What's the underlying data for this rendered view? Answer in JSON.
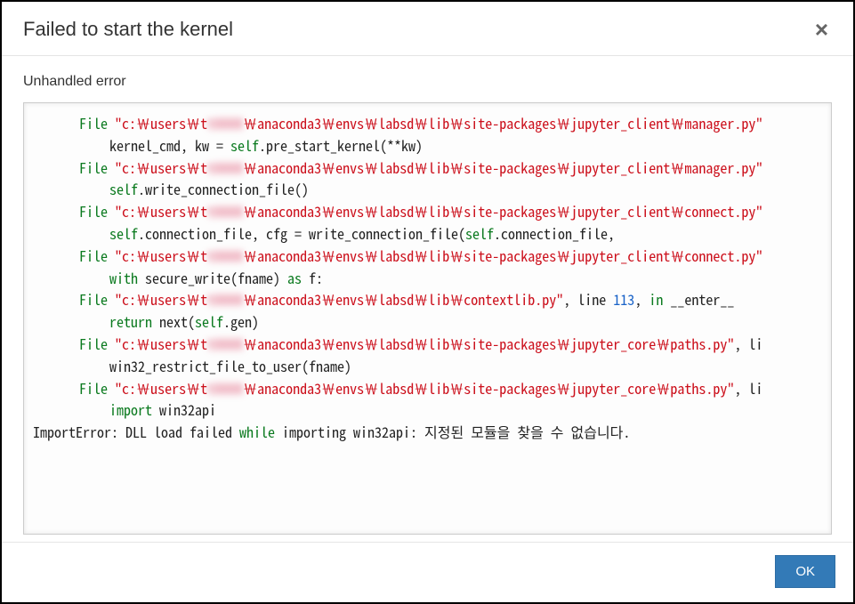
{
  "modal": {
    "title": "Failed to start the kernel",
    "close_glyph": "×",
    "error_heading": "Unhandled error",
    "redacted_user": "tXXXX",
    "trace": [
      {
        "type": "file",
        "path": "c:\\users\\t████\\anaconda3\\envs\\labsd\\lib\\site-packages\\jupyter_client\\manager.py"
      },
      {
        "type": "code",
        "tokens": [
          {
            "t": "plain",
            "v": "kernel_cmd, kw = "
          },
          {
            "t": "self",
            "v": "self"
          },
          {
            "t": "plain",
            "v": ".pre_start_kernel(**kw)"
          }
        ]
      },
      {
        "type": "file",
        "path": "c:\\users\\t████\\anaconda3\\envs\\labsd\\lib\\site-packages\\jupyter_client\\manager.py"
      },
      {
        "type": "code",
        "tokens": [
          {
            "t": "self",
            "v": "self"
          },
          {
            "t": "plain",
            "v": ".write_connection_file()"
          }
        ]
      },
      {
        "type": "file",
        "path": "c:\\users\\t████\\anaconda3\\envs\\labsd\\lib\\site-packages\\jupyter_client\\connect.py"
      },
      {
        "type": "code",
        "tokens": [
          {
            "t": "self",
            "v": "self"
          },
          {
            "t": "plain",
            "v": ".connection_file, cfg = write_connection_file("
          },
          {
            "t": "self",
            "v": "self"
          },
          {
            "t": "plain",
            "v": ".connection_file,"
          }
        ]
      },
      {
        "type": "file",
        "path": "c:\\users\\t████\\anaconda3\\envs\\labsd\\lib\\site-packages\\jupyter_client\\connect.py"
      },
      {
        "type": "code",
        "tokens": [
          {
            "t": "with",
            "v": "with"
          },
          {
            "t": "plain",
            "v": " secure_write(fname) "
          },
          {
            "t": "as",
            "v": "as"
          },
          {
            "t": "plain",
            "v": " f:"
          }
        ]
      },
      {
        "type": "file",
        "path": "c:\\users\\t████\\anaconda3\\envs\\labsd\\lib\\contextlib.py",
        "tail": [
          {
            "t": "plain",
            "v": ", line "
          },
          {
            "t": "num",
            "v": "113"
          },
          {
            "t": "plain",
            "v": ", "
          },
          {
            "t": "in",
            "v": "in"
          },
          {
            "t": "plain",
            "v": " __enter__"
          }
        ]
      },
      {
        "type": "code",
        "tokens": [
          {
            "t": "return",
            "v": "return"
          },
          {
            "t": "plain",
            "v": " next("
          },
          {
            "t": "self",
            "v": "self"
          },
          {
            "t": "plain",
            "v": ".gen)"
          }
        ]
      },
      {
        "type": "file",
        "path": "c:\\users\\t████\\anaconda3\\envs\\labsd\\lib\\site-packages\\jupyter_core\\paths.py",
        "tail": [
          {
            "t": "plain",
            "v": ", li"
          }
        ]
      },
      {
        "type": "code",
        "tokens": [
          {
            "t": "plain",
            "v": "win32_restrict_file_to_user(fname)"
          }
        ]
      },
      {
        "type": "file",
        "path": "c:\\users\\t████\\anaconda3\\envs\\labsd\\lib\\site-packages\\jupyter_core\\paths.py",
        "tail": [
          {
            "t": "plain",
            "v": ", li"
          }
        ]
      },
      {
        "type": "code",
        "tokens": [
          {
            "t": "import",
            "v": "import"
          },
          {
            "t": "plain",
            "v": " win32api"
          }
        ]
      },
      {
        "type": "final",
        "tokens": [
          {
            "t": "plain",
            "v": "ImportError: DLL load failed "
          },
          {
            "t": "while",
            "v": "while"
          },
          {
            "t": "plain",
            "v": " importing win32api: 지정된 모듈을 찾을 수 없습니다."
          }
        ]
      }
    ],
    "ok_label": "OK"
  }
}
